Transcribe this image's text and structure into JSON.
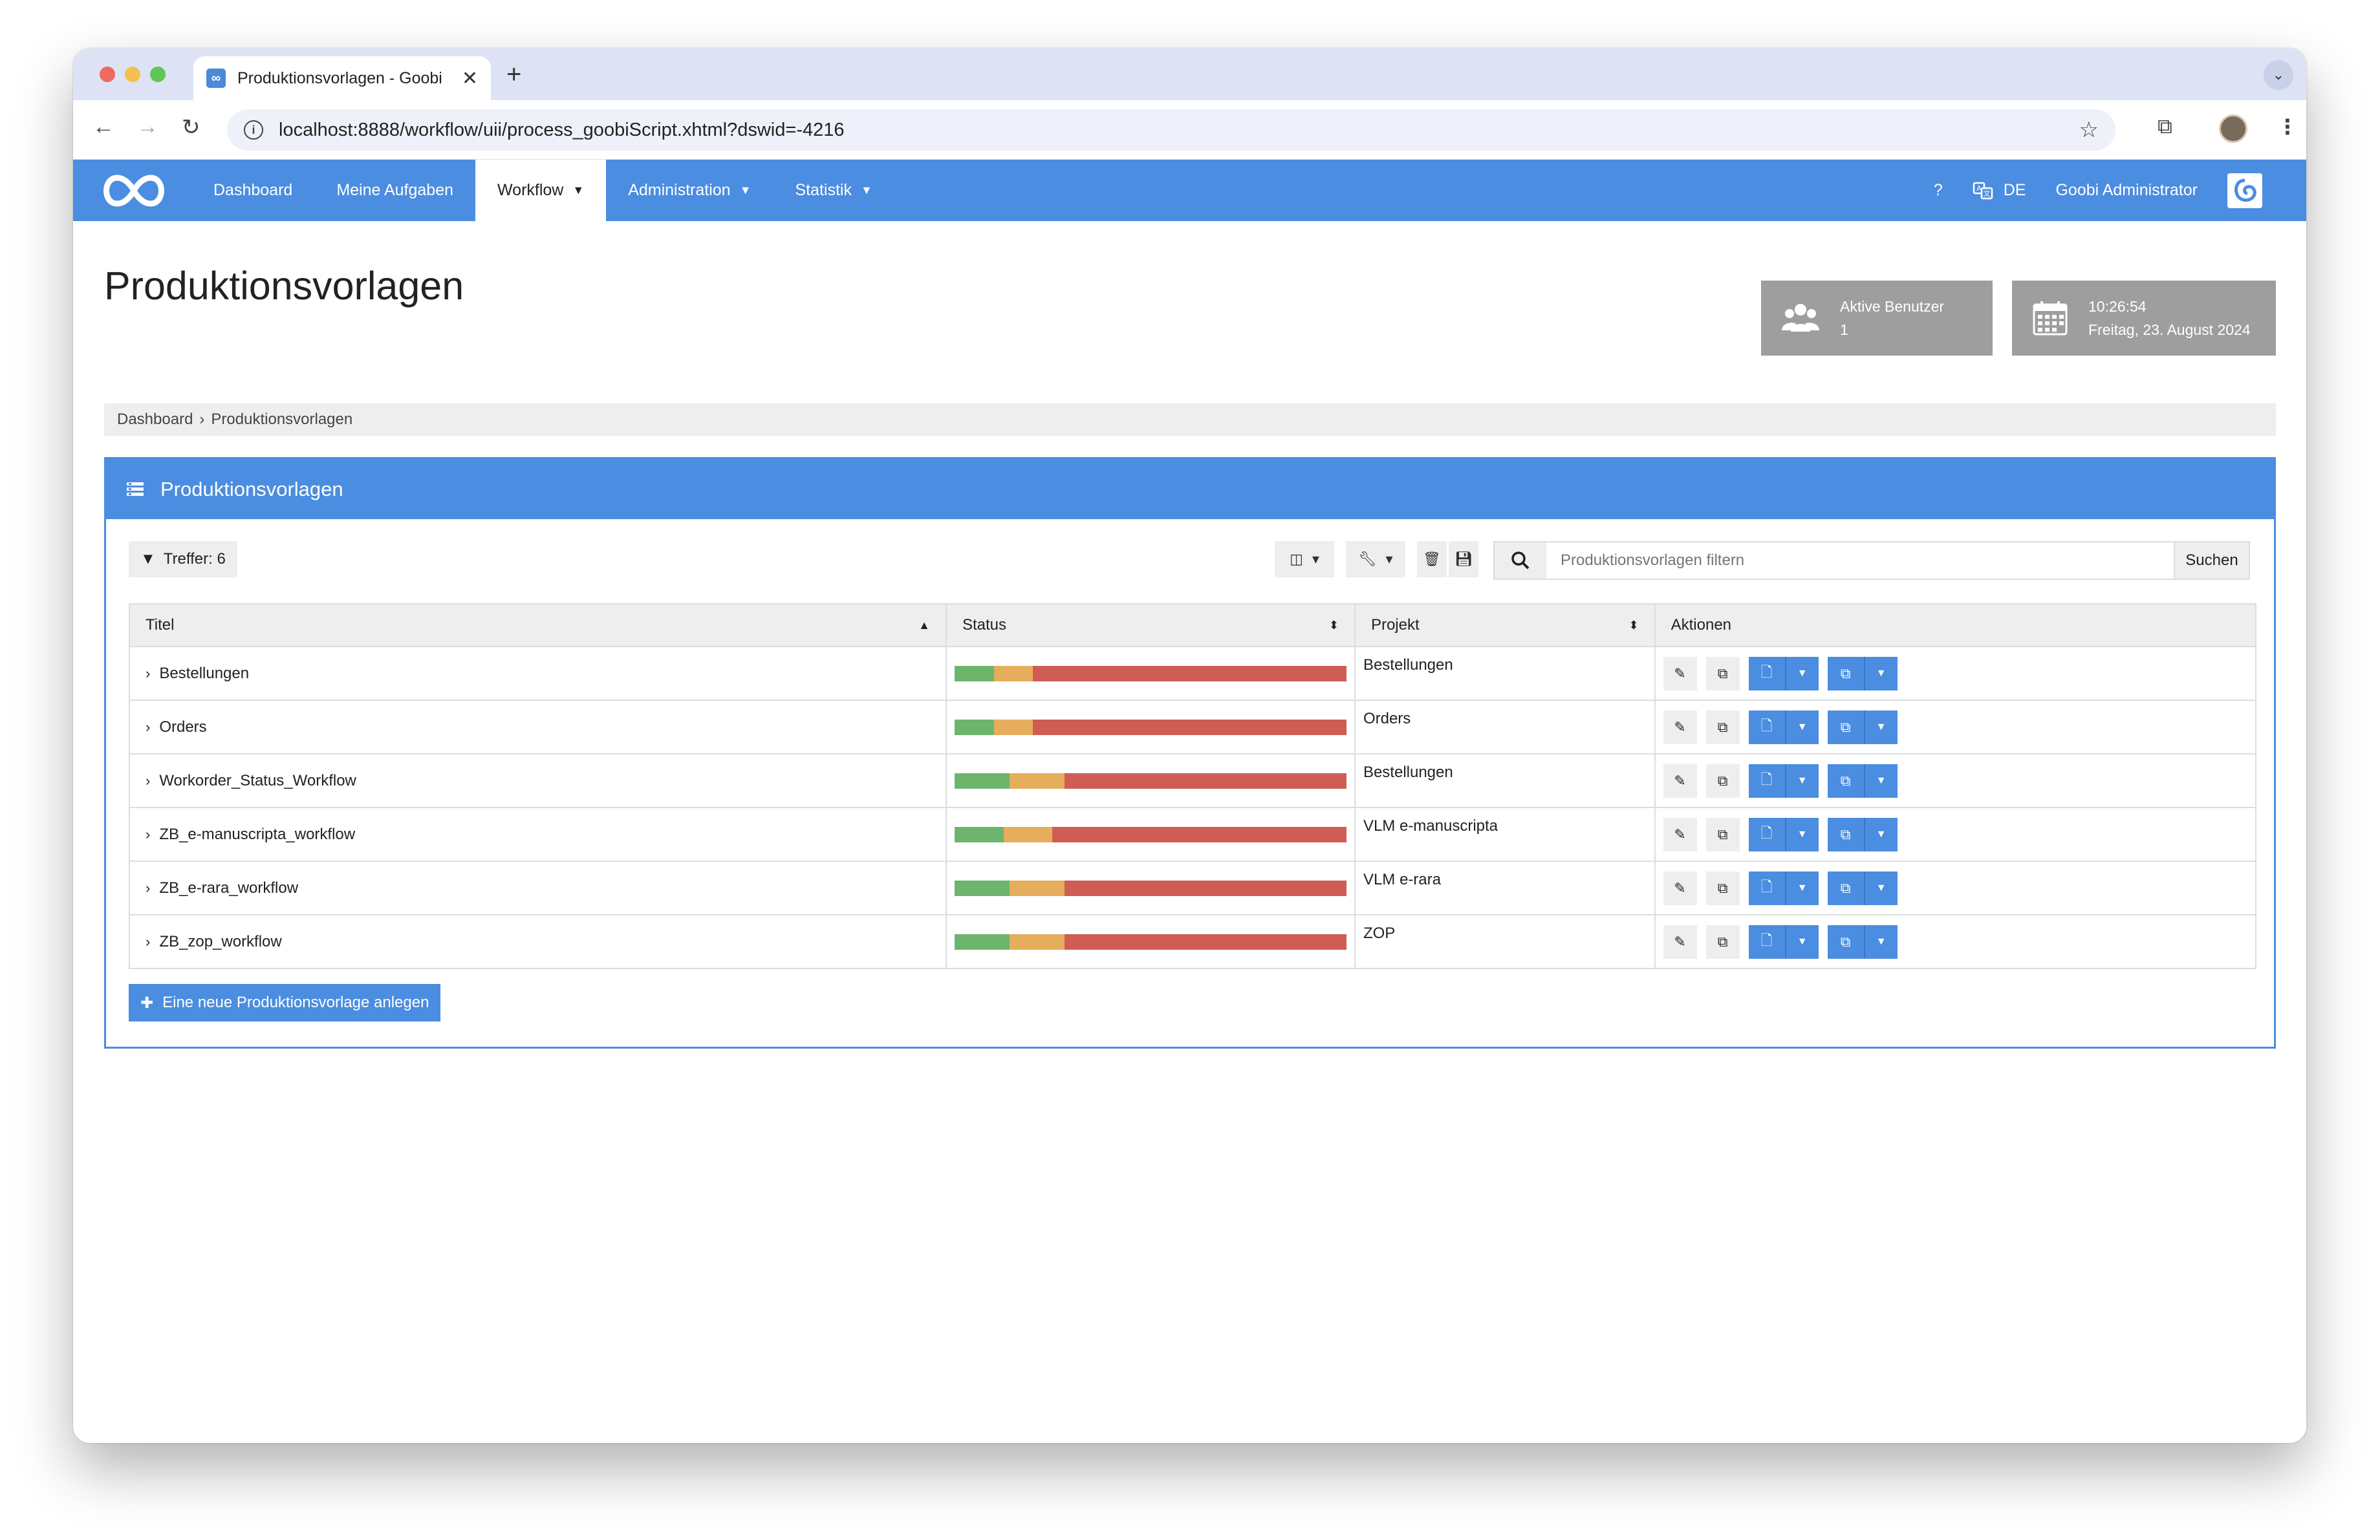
{
  "browser": {
    "tab_title": "Produktionsvorlagen - Goobi",
    "url": "localhost:8888/workflow/uii/process_goobiScript.xhtml?dswid=-4216"
  },
  "nav": {
    "items": [
      {
        "label": "Dashboard",
        "active": false,
        "dropdown": false
      },
      {
        "label": "Meine Aufgaben",
        "active": false,
        "dropdown": false
      },
      {
        "label": "Workflow",
        "active": true,
        "dropdown": true
      },
      {
        "label": "Administration",
        "active": false,
        "dropdown": true
      },
      {
        "label": "Statistik",
        "active": false,
        "dropdown": true
      }
    ],
    "help": "?",
    "language": "DE",
    "user": "Goobi Administrator"
  },
  "page": {
    "title": "Produktionsvorlagen"
  },
  "tiles": {
    "users_label": "Aktive Benutzer",
    "users_count": "1",
    "time": "10:26:54",
    "date": "Freitag, 23. August 2024"
  },
  "breadcrumb": {
    "home": "Dashboard",
    "separator": "›",
    "current": "Produktionsvorlagen"
  },
  "panel": {
    "title": "Produktionsvorlagen",
    "filter_label": "Treffer: 6",
    "search_placeholder": "Produktionsvorlagen filtern",
    "search_button": "Suchen",
    "add_button": "Eine neue Produktionsvorlage anlegen"
  },
  "table": {
    "headers": {
      "title": "Titel",
      "status": "Status",
      "project": "Projekt",
      "actions": "Aktionen"
    },
    "rows": [
      {
        "title": "Bestellungen",
        "project": "Bestellungen",
        "status": [
          0.1,
          0.1,
          0.8
        ]
      },
      {
        "title": "Orders",
        "project": "Orders",
        "status": [
          0.1,
          0.1,
          0.8
        ]
      },
      {
        "title": "Workorder_Status_Workflow",
        "project": "Bestellungen",
        "status": [
          0.14,
          0.14,
          0.72
        ]
      },
      {
        "title": "ZB_e-manuscripta_workflow",
        "project": "VLM e-manuscripta",
        "status": [
          0.125,
          0.125,
          0.75
        ]
      },
      {
        "title": "ZB_e-rara_workflow",
        "project": "VLM e-rara",
        "status": [
          0.14,
          0.14,
          0.72
        ]
      },
      {
        "title": "ZB_zop_workflow",
        "project": "ZOP",
        "status": [
          0.14,
          0.14,
          0.72
        ]
      }
    ]
  },
  "colors": {
    "primary": "#4b8de0",
    "status_done": "#6db56d",
    "status_inwork": "#e6ad5c",
    "status_open": "#cf5c55"
  }
}
